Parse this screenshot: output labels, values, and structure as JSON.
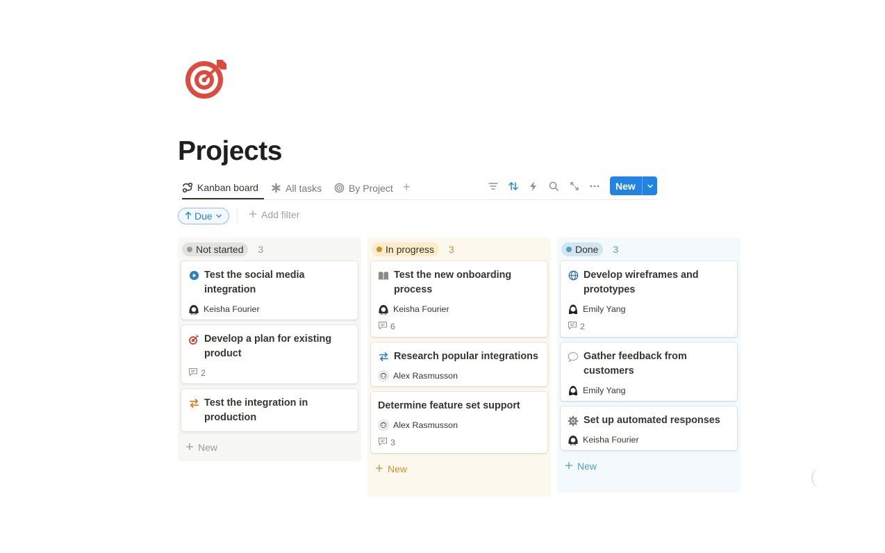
{
  "page": {
    "title": "Projects",
    "icon": "target-icon"
  },
  "tabs": [
    {
      "label": "Kanban board",
      "icon": "kanban-icon",
      "active": true
    },
    {
      "label": "All tasks",
      "icon": "asterisk-icon",
      "active": false
    },
    {
      "label": "By Project",
      "icon": "target-ring-icon",
      "active": false
    }
  ],
  "toolbar": {
    "icons": [
      "filter-icon",
      "sort-icon",
      "automation-icon",
      "search-icon",
      "expand-icon",
      "more-icon"
    ],
    "new_label": "New"
  },
  "filters": {
    "sort_label": "Due",
    "add_filter_label": "Add filter"
  },
  "colors": {
    "accent": "#2383e2"
  },
  "columns": [
    {
      "name": "Not started",
      "count": "3",
      "dot": "#9b9a97",
      "pill_bg": "#e3e2e0",
      "col_bg": "#f7f7f5",
      "count_color": "#9b9a97",
      "new_color": "#9b9a97",
      "new_label": "New",
      "cards": [
        {
          "title": "Test the social media integration",
          "icon": "play-circle-icon",
          "assignee": "Keisha Fourier",
          "comments": ""
        },
        {
          "title": "Develop a plan for existing product",
          "icon": "target-icon",
          "assignee": "",
          "comments": "2"
        },
        {
          "title": "Test the integration in production",
          "icon": "arrows-icon",
          "assignee": "",
          "comments": ""
        }
      ]
    },
    {
      "name": "In progress",
      "count": "3",
      "dot": "#cb912f",
      "pill_bg": "#fdecc8",
      "col_bg": "#fcf8ee",
      "count_color": "#cb912f",
      "new_color": "#cb912f",
      "new_label": "New",
      "cards": [
        {
          "title": "Test the new onboarding process",
          "icon": "book-icon",
          "assignee": "Keisha Fourier",
          "comments": "6"
        },
        {
          "title": "Research popular integrations",
          "icon": "arrows-icon",
          "assignee": "Alex Rasmusson",
          "comments": ""
        },
        {
          "title": "Determine feature set support",
          "icon": "",
          "assignee": "Alex Rasmusson",
          "comments": "3"
        }
      ]
    },
    {
      "name": "Done",
      "count": "3",
      "dot": "#529cca",
      "pill_bg": "#d3e5ef",
      "col_bg": "#f3f9fc",
      "count_color": "#529cca",
      "new_color": "#529cca",
      "new_label": "New",
      "cards": [
        {
          "title": "Develop wireframes and prototypes",
          "icon": "globe-icon",
          "assignee": "Emily Yang",
          "comments": "2"
        },
        {
          "title": "Gather feedback from customers",
          "icon": "speech-bubble-icon",
          "assignee": "Emily Yang",
          "comments": ""
        },
        {
          "title": "Set up automated responses",
          "icon": "gear-icon",
          "assignee": "Keisha Fourier",
          "comments": ""
        }
      ]
    }
  ]
}
